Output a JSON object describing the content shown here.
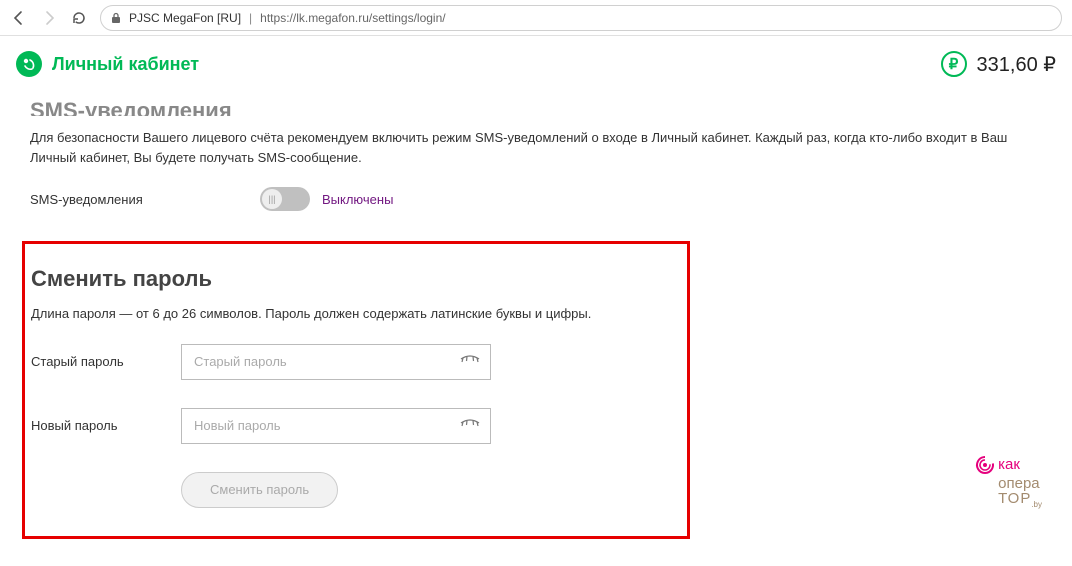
{
  "browser": {
    "site_identity": "PJSC MegaFon [RU]",
    "separator": "|",
    "url": "https://lk.megafon.ru/settings/login/"
  },
  "header": {
    "brand_title": "Личный кабинет",
    "balance": "331,60 ₽"
  },
  "sms_section": {
    "title": "SMS-уведомления",
    "description": "Для безопасности Вашего лицевого счёта рекомендуем включить режим SMS-уведомлений о входе в Личный кабинет. Каждый раз, когда кто-либо входит в Ваш Личный кабинет, Вы будете получать SMS-сообщение.",
    "toggle_label": "SMS-уведомления",
    "toggle_state": "Выключены"
  },
  "password_section": {
    "title": "Сменить пароль",
    "description": "Длина пароля — от 6 до 26 символов. Пароль должен содержать латинские буквы и цифры.",
    "old_label": "Старый пароль",
    "old_placeholder": "Старый пароль",
    "new_label": "Новый пароль",
    "new_placeholder": "Новый пароль",
    "submit_label": "Сменить пароль"
  },
  "watermark": {
    "l1": "как",
    "l2a": "опера",
    "l2b": "ТОР",
    "suffix": ".by"
  },
  "colors": {
    "brand_green": "#00b956",
    "highlight_red": "#e60000",
    "accent_purple": "#731982",
    "wm_pink": "#e5007d",
    "wm_brown": "#a38b6f"
  }
}
